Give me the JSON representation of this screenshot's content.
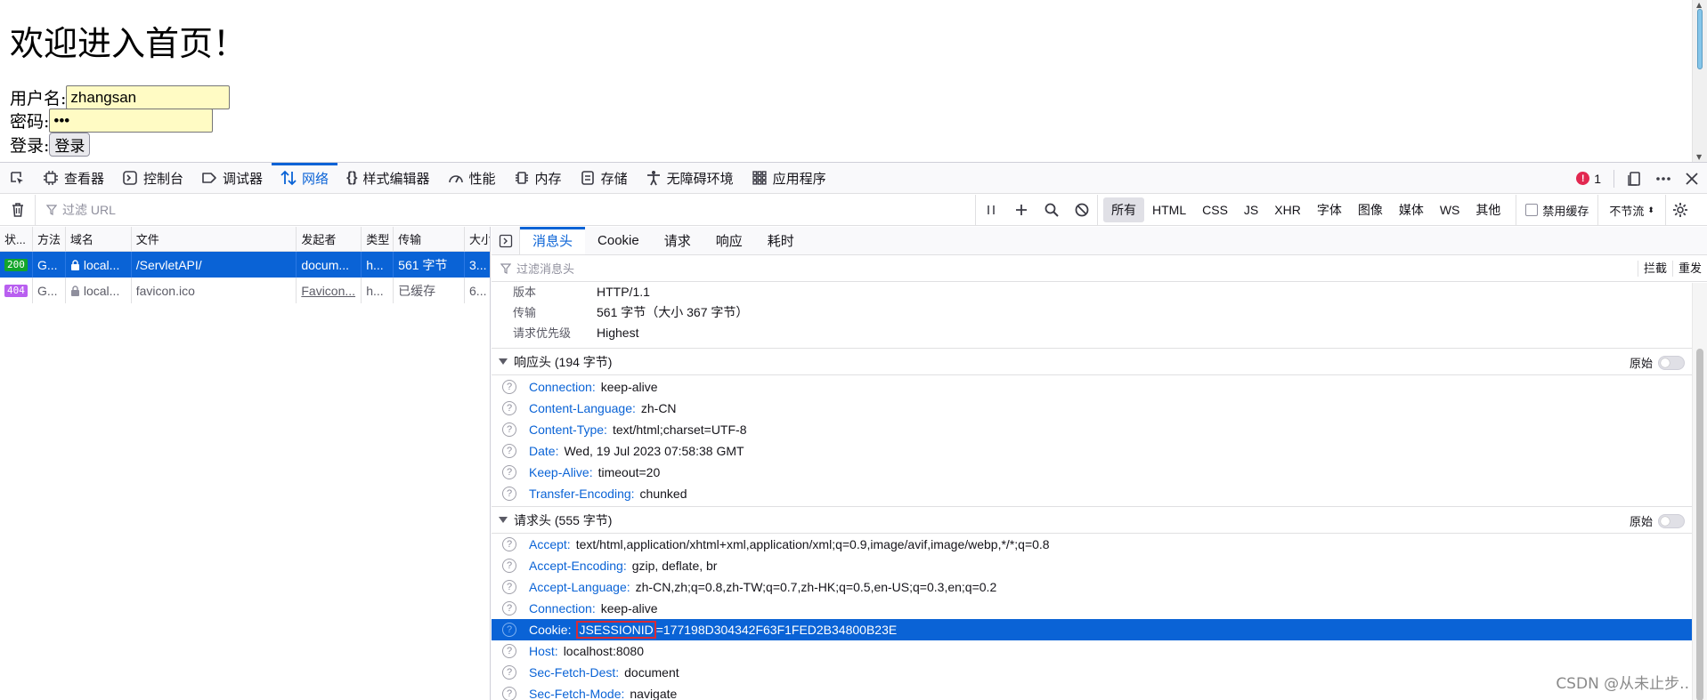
{
  "content": {
    "heading": "欢迎进入首页！",
    "username_label": "用户名:",
    "username_value": "zhangsan",
    "password_label": "密码:",
    "password_value": "•••",
    "login_label": "登录:",
    "login_button": "登录"
  },
  "devtools": {
    "tabs": [
      {
        "label": "查看器",
        "icon": "inspector-icon"
      },
      {
        "label": "控制台",
        "icon": "console-icon"
      },
      {
        "label": "调试器",
        "icon": "debugger-icon"
      },
      {
        "label": "网络",
        "icon": "network-icon",
        "active": true
      },
      {
        "label": "样式编辑器",
        "icon": "style-editor-icon"
      },
      {
        "label": "性能",
        "icon": "performance-icon"
      },
      {
        "label": "内存",
        "icon": "memory-icon"
      },
      {
        "label": "存储",
        "icon": "storage-icon"
      },
      {
        "label": "无障碍环境",
        "icon": "accessibility-icon"
      },
      {
        "label": "应用程序",
        "icon": "application-icon"
      }
    ],
    "error_count": "1",
    "filter_placeholder": "过滤 URL",
    "type_filters": [
      "所有",
      "HTML",
      "CSS",
      "JS",
      "XHR",
      "字体",
      "图像",
      "媒体",
      "WS",
      "其他"
    ],
    "disable_cache": "禁用缓存",
    "throttle": "不节流",
    "columns": [
      "状...",
      "方法",
      "域名",
      "文件",
      "发起者",
      "类型",
      "传输",
      "大小"
    ],
    "requests": [
      {
        "status": "200",
        "method": "G...",
        "domain": "local...",
        "file": "/ServletAPI/",
        "initiator": "docum...",
        "type": "h...",
        "transfer": "561 字节",
        "size": "3..."
      },
      {
        "status": "404",
        "method": "G...",
        "domain": "local...",
        "file": "favicon.ico",
        "initiator": "Favicon...",
        "type": "h...",
        "transfer": "已缓存",
        "size": "6..."
      }
    ],
    "side_tabs": [
      "消息头",
      "Cookie",
      "请求",
      "响应",
      "耗时"
    ],
    "header_filter_placeholder": "过滤消息头",
    "block_label": "拦截",
    "resend_label": "重发",
    "summary": [
      {
        "key": "版本",
        "value": "HTTP/1.1"
      },
      {
        "key": "传输",
        "value": "561 字节（大小 367 字节）"
      },
      {
        "key": "请求优先级",
        "value": "Highest"
      }
    ],
    "response_section": "响应头 (194 字节)",
    "request_section": "请求头 (555 字节)",
    "raw_label": "原始",
    "response_headers": [
      {
        "name": "Connection:",
        "value": "keep-alive"
      },
      {
        "name": "Content-Language:",
        "value": "zh-CN"
      },
      {
        "name": "Content-Type:",
        "value": "text/html;charset=UTF-8"
      },
      {
        "name": "Date:",
        "value": "Wed, 19 Jul 2023 07:58:38 GMT"
      },
      {
        "name": "Keep-Alive:",
        "value": "timeout=20"
      },
      {
        "name": "Transfer-Encoding:",
        "value": "chunked"
      }
    ],
    "request_headers": [
      {
        "name": "Accept:",
        "value": "text/html,application/xhtml+xml,application/xml;q=0.9,image/avif,image/webp,*/*;q=0.8"
      },
      {
        "name": "Accept-Encoding:",
        "value": "gzip, deflate, br"
      },
      {
        "name": "Accept-Language:",
        "value": "zh-CN,zh;q=0.8,zh-TW;q=0.7,zh-HK;q=0.5,en-US;q=0.3,en;q=0.2"
      },
      {
        "name": "Connection:",
        "value": "keep-alive"
      },
      {
        "name": "Cookie:",
        "value_highlight": "JSESSIONID",
        "value_rest": "=177198D304342F63F1FED2B34800B23E"
      },
      {
        "name": "Host:",
        "value": "localhost:8080"
      },
      {
        "name": "Sec-Fetch-Dest:",
        "value": "document"
      },
      {
        "name": "Sec-Fetch-Mode:",
        "value": "navigate"
      }
    ]
  },
  "watermark": "CSDN @从未止步.."
}
